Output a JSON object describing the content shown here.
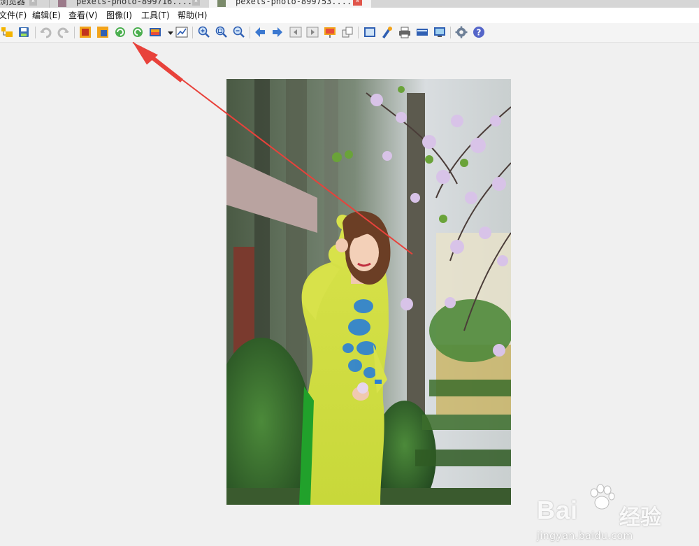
{
  "tabs": [
    {
      "label": "浏览器",
      "active": false
    },
    {
      "label": "pexels-photo-899716....",
      "active": false
    },
    {
      "label": "pexels-photo-899753....",
      "active": true
    }
  ],
  "menu": [
    {
      "label": "文件(F)"
    },
    {
      "label": "编辑(E)"
    },
    {
      "label": "查看(V)"
    },
    {
      "label": "图像(I)"
    },
    {
      "label": "工具(T)"
    },
    {
      "label": "帮助(H)"
    }
  ],
  "toolbar": [
    "open-folder-icon",
    "save-icon",
    "undo-icon",
    "redo-icon",
    "crop-icon",
    "resize-icon",
    "rotate-left-icon",
    "rotate-right-icon",
    "color-adjust-icon",
    "histogram-icon",
    "zoom-in-icon",
    "zoom-fit-icon",
    "zoom-out-icon",
    "previous-icon",
    "next-icon",
    "first-image-icon",
    "last-image-icon",
    "slideshow-icon",
    "copy-to-icon",
    "fullscreen-icon",
    "paint-icon",
    "print-icon",
    "scanner-icon",
    "wallpaper-icon",
    "settings-icon",
    "help-icon"
  ],
  "colors": {
    "annotation_arrow": "#e8423b",
    "active_tab_close": "#e0554a"
  },
  "watermark": {
    "brand": "Bai",
    "suffix": "经验",
    "url": "jingyan.baidu.com"
  }
}
